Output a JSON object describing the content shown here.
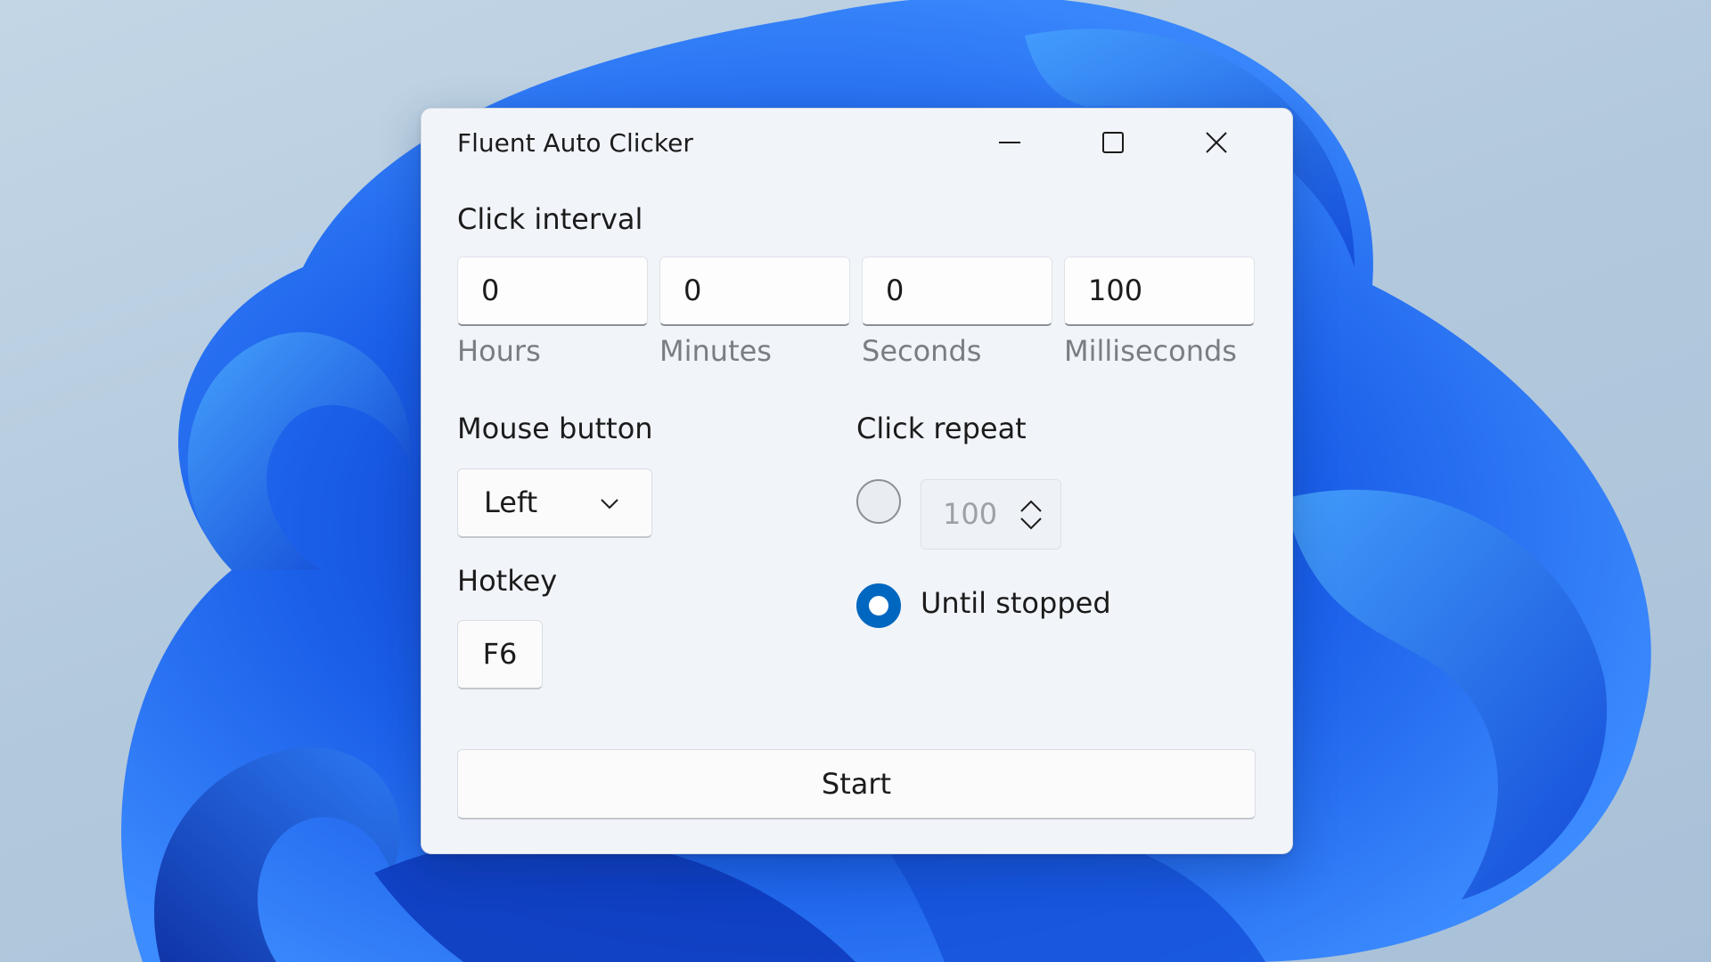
{
  "window": {
    "title": "Fluent Auto Clicker"
  },
  "caption_buttons": {
    "minimize_icon": "minimize-icon",
    "maximize_icon": "maximize-icon",
    "close_icon": "close-icon"
  },
  "click_interval": {
    "label": "Click interval",
    "fields": [
      {
        "value": "0",
        "caption": "Hours"
      },
      {
        "value": "0",
        "caption": "Minutes"
      },
      {
        "value": "0",
        "caption": "Seconds"
      },
      {
        "value": "100",
        "caption": "Milliseconds"
      }
    ]
  },
  "mouse_button": {
    "label": "Mouse button",
    "selected": "Left",
    "icon": "chevron-down-icon"
  },
  "hotkey": {
    "label": "Hotkey",
    "value": "F6"
  },
  "click_repeat": {
    "label": "Click repeat",
    "count_value": "100",
    "count_selected": false,
    "until_stopped_label": "Until stopped",
    "until_stopped_selected": true
  },
  "start_button": {
    "label": "Start"
  },
  "colors": {
    "accent": "#0067c0",
    "window_bg": "#f1f4f9",
    "text": "#1b1b1b",
    "caption_text": "#7a7d82",
    "disabled_text": "#9da1a6"
  }
}
